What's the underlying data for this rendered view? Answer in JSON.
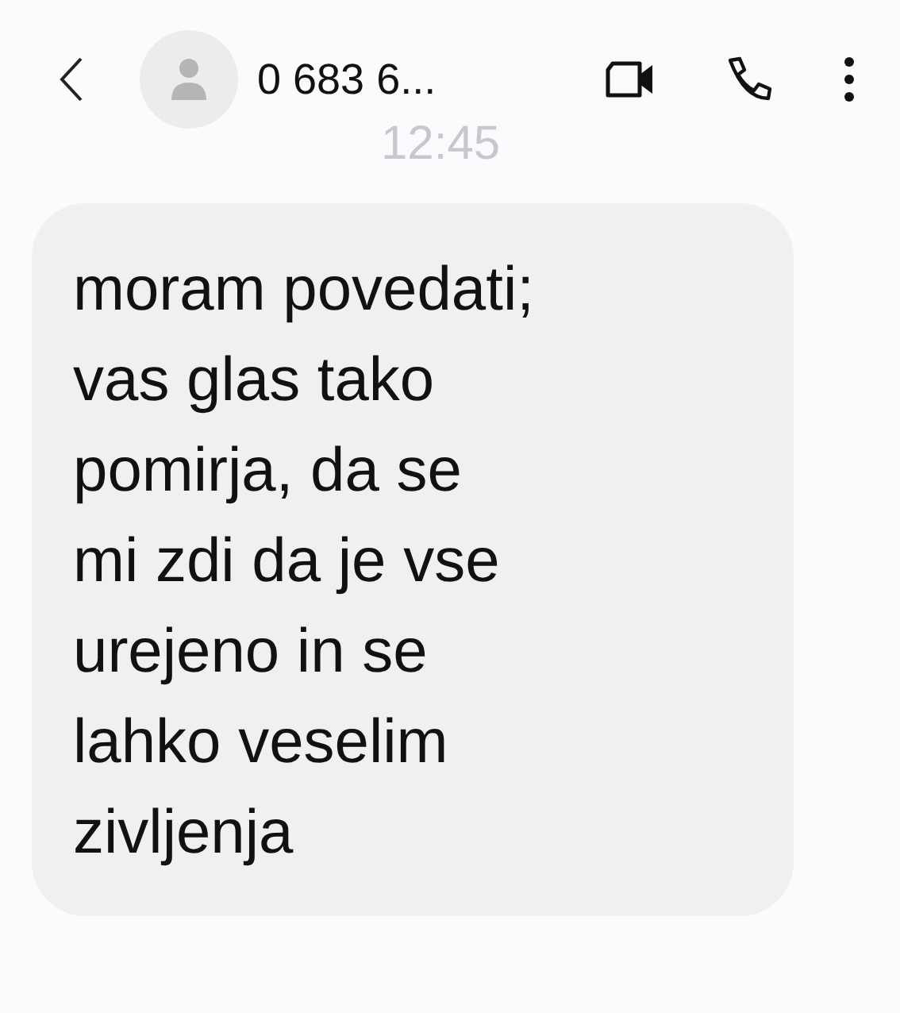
{
  "header": {
    "contact": "0 683 6...",
    "time": "12:45"
  },
  "messages": [
    {
      "kind": "received",
      "text": "moram povedati;\nvas glas tako\npomirja, da se\nmi zdi da je vse\nurejeno in se\nlahko veselim\nzivljenja"
    }
  ]
}
